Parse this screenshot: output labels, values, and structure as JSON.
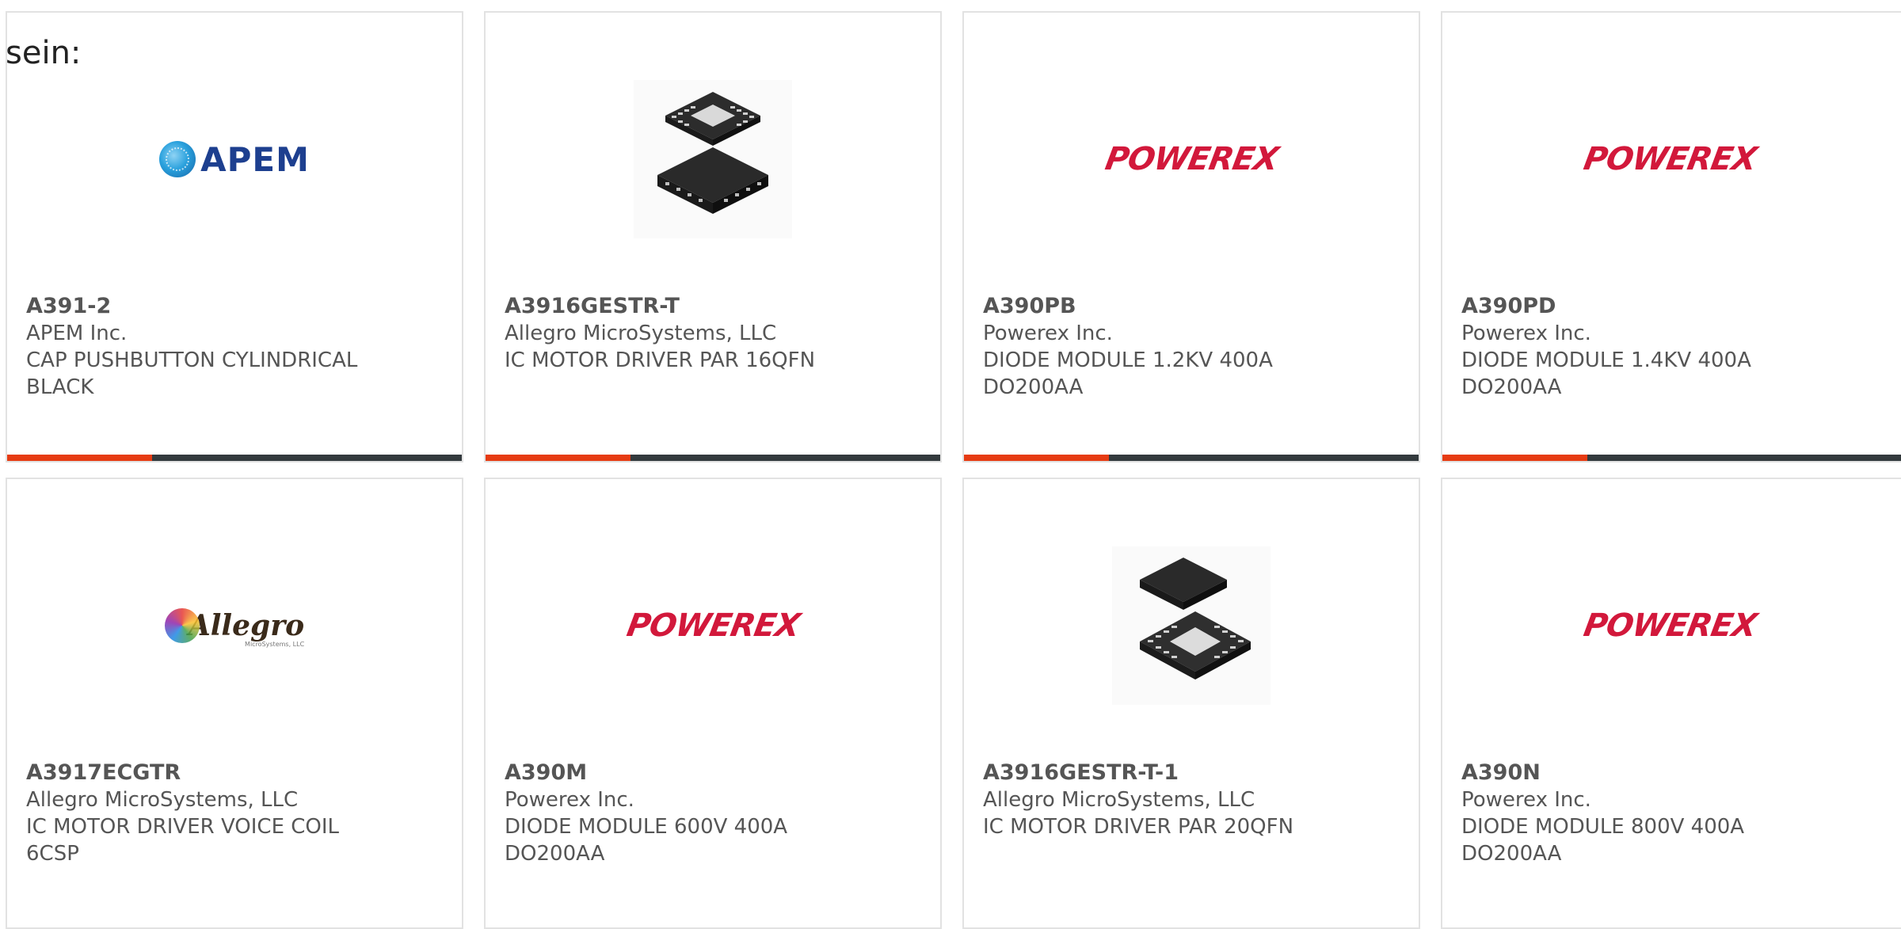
{
  "intro_text": "sein:",
  "colors": {
    "accent": "#e63b12",
    "bar": "#333a3d",
    "text": "#555555",
    "border": "#e2e2e2"
  },
  "products": [
    {
      "part_number": "A391-2",
      "manufacturer": "APEM Inc.",
      "description": "CAP PUSHBUTTON CYLINDRICAL BLACK",
      "logo": "apem-logo",
      "logo_text": "APEM"
    },
    {
      "part_number": "A3916GESTR-T",
      "manufacturer": "Allegro MicroSystems, LLC",
      "description": "IC MOTOR DRIVER PAR 16QFN",
      "logo": "qfn-chip-image"
    },
    {
      "part_number": "A390PB",
      "manufacturer": "Powerex Inc.",
      "description": "DIODE MODULE 1.2KV 400A DO200AA",
      "logo": "powerex-logo",
      "logo_text": "POWEREX"
    },
    {
      "part_number": "A390PD",
      "manufacturer": "Powerex Inc.",
      "description": "DIODE MODULE 1.4KV 400A DO200AA",
      "logo": "powerex-logo",
      "logo_text": "POWEREX"
    },
    {
      "part_number": "A3917ECGTR",
      "manufacturer": "Allegro MicroSystems, LLC",
      "description": "IC MOTOR DRIVER VOICE COIL 6CSP",
      "logo": "allegro-logo",
      "logo_text": "Allegro",
      "logo_subtext": "MicroSystems, LLC"
    },
    {
      "part_number": "A390M",
      "manufacturer": "Powerex Inc.",
      "description": "DIODE MODULE 600V 400A DO200AA",
      "logo": "powerex-logo",
      "logo_text": "POWEREX"
    },
    {
      "part_number": "A3916GESTR-T-1",
      "manufacturer": "Allegro MicroSystems, LLC",
      "description": "IC MOTOR DRIVER PAR 20QFN",
      "logo": "qfn-chip-image"
    },
    {
      "part_number": "A390N",
      "manufacturer": "Powerex Inc.",
      "description": "DIODE MODULE 800V 400A DO200AA",
      "logo": "powerex-logo",
      "logo_text": "POWEREX"
    }
  ]
}
